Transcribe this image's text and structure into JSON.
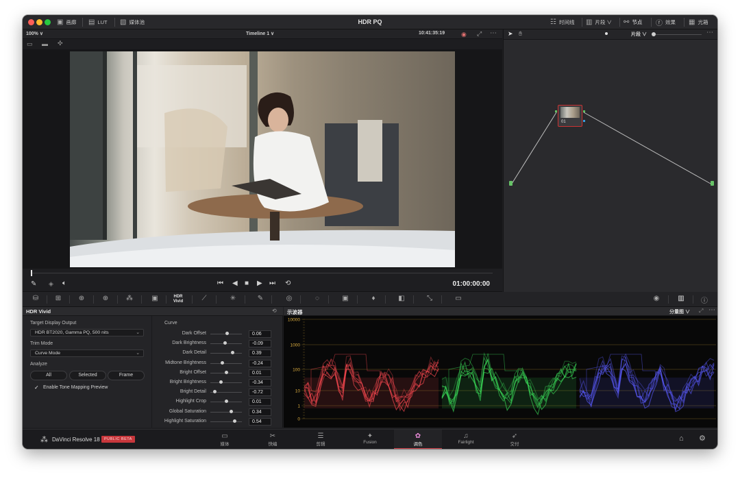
{
  "app": {
    "title": "HDR PQ",
    "brand": "DaVinci Resolve 18",
    "badge": "PUBLIC BETA"
  },
  "titlebar": {
    "left": [
      {
        "label": "画廊",
        "icon": "gallery-icon"
      },
      {
        "label": "LUT",
        "icon": "lut-icon"
      },
      {
        "label": "媒体池",
        "icon": "media-pool-icon"
      }
    ],
    "right": [
      {
        "label": "时间线",
        "icon": "timeline-icon"
      },
      {
        "label": "片段 ∨",
        "icon": "clips-icon"
      },
      {
        "label": "节点",
        "icon": "nodes-icon"
      },
      {
        "label": "效果",
        "icon": "effects-icon"
      },
      {
        "label": "光箱",
        "icon": "lightbox-icon"
      }
    ]
  },
  "viewer": {
    "zoom": "100% ∨",
    "timeline": "Timeline 1 ∨",
    "time_of_day": "10:41:35:19",
    "timecode": "01:00:00:00"
  },
  "node_editor": {
    "mode_label": "片段 ∨",
    "node_label": "01"
  },
  "hdr_panel": {
    "title": "HDR Vivid",
    "target_display_label": "Target Display Output",
    "target_display_value": "HDR BT2020, Gamma PQ, 500 nits",
    "trim_mode_label": "Trim Mode",
    "trim_mode_value": "Curve Mode",
    "analyze_label": "Analyze",
    "analyze_buttons": [
      "All",
      "Selected",
      "Frame"
    ],
    "tone_mapping_label": "Enable Tone Mapping Preview",
    "tone_mapping_checked": true,
    "curve_label": "Curve",
    "curve_params": [
      {
        "name": "Dark Offset",
        "value": "0.06",
        "pos": 0.53
      },
      {
        "name": "Dark Brightness",
        "value": "-0.09",
        "pos": 0.46
      },
      {
        "name": "Dark Detail",
        "value": "0.39",
        "pos": 0.7
      },
      {
        "name": "Midtone Brightness",
        "value": "-0.24",
        "pos": 0.38
      },
      {
        "name": "Bright Offset",
        "value": "0.01",
        "pos": 0.5
      },
      {
        "name": "Bright Brightness",
        "value": "-0.34",
        "pos": 0.33
      },
      {
        "name": "Bright Detail",
        "value": "-0.72",
        "pos": 0.14
      },
      {
        "name": "Highlight Crop",
        "value": "0.01",
        "pos": 0.5
      },
      {
        "name": "Global Saturation",
        "value": "0.34",
        "pos": 0.67
      },
      {
        "name": "Highlight Saturation",
        "value": "0.54",
        "pos": 0.77
      }
    ]
  },
  "scope": {
    "title": "示波器",
    "mode": "分量图 ∨",
    "scale_labels": [
      "10000",
      "1000",
      "100",
      "10",
      "1",
      "0"
    ]
  },
  "pages": [
    {
      "label": "媒体",
      "icon": "media-page-icon",
      "glyph": "▭"
    },
    {
      "label": "快编",
      "icon": "cut-page-icon",
      "glyph": "✂"
    },
    {
      "label": "剪辑",
      "icon": "edit-page-icon",
      "glyph": "☰"
    },
    {
      "label": "Fusion",
      "icon": "fusion-page-icon",
      "glyph": "✦"
    },
    {
      "label": "调色",
      "icon": "color-page-icon",
      "glyph": "✿",
      "active": true
    },
    {
      "label": "Fairlight",
      "icon": "fairlight-page-icon",
      "glyph": "♫"
    },
    {
      "label": "交付",
      "icon": "deliver-page-icon",
      "glyph": "➶"
    }
  ],
  "colors": {
    "accent": "#d8454d",
    "red_trace": "#ff4a52",
    "green_trace": "#3ce05a",
    "blue_trace": "#5b5cff"
  }
}
